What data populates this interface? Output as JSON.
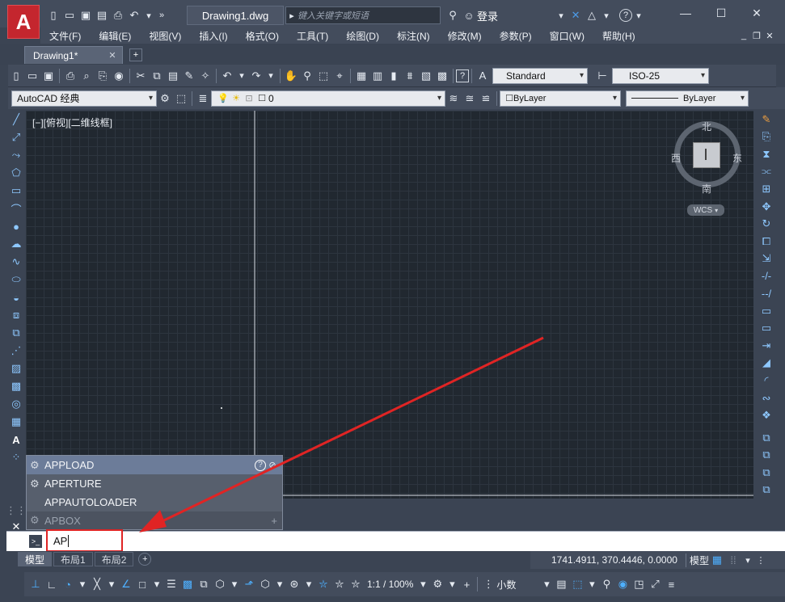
{
  "title": {
    "document": "Drawing1.dwg",
    "search_placeholder": "键入关键字或短语",
    "login": "登录"
  },
  "menu": [
    "文件(F)",
    "编辑(E)",
    "视图(V)",
    "插入(I)",
    "格式(O)",
    "工具(T)",
    "绘图(D)",
    "标注(N)",
    "修改(M)",
    "参数(P)",
    "窗口(W)",
    "帮助(H)"
  ],
  "tabs": {
    "active": "Drawing1*"
  },
  "toolbar": {
    "text_style": "Standard",
    "dim_style": "ISO-25",
    "workspace": "AutoCAD 经典",
    "layer": "0",
    "color": "ByLayer",
    "linetype": "ByLayer"
  },
  "viewport": {
    "label": "[−][俯视][二维线框]"
  },
  "viewcube": {
    "north": "北",
    "south": "南",
    "east": "东",
    "west": "西",
    "wcs": "WCS"
  },
  "autocomplete": {
    "items": [
      "APPLOAD",
      "APERTURE",
      "APPAUTOLOADER",
      "APBOX"
    ]
  },
  "command": {
    "value": "AP"
  },
  "layout_tabs": [
    "模型",
    "布局1",
    "布局2"
  ],
  "status": {
    "coordinates": "1741.4911, 370.4446, 0.0000",
    "model": "模型",
    "scale": "1:1 / 100%",
    "units": "小数"
  }
}
